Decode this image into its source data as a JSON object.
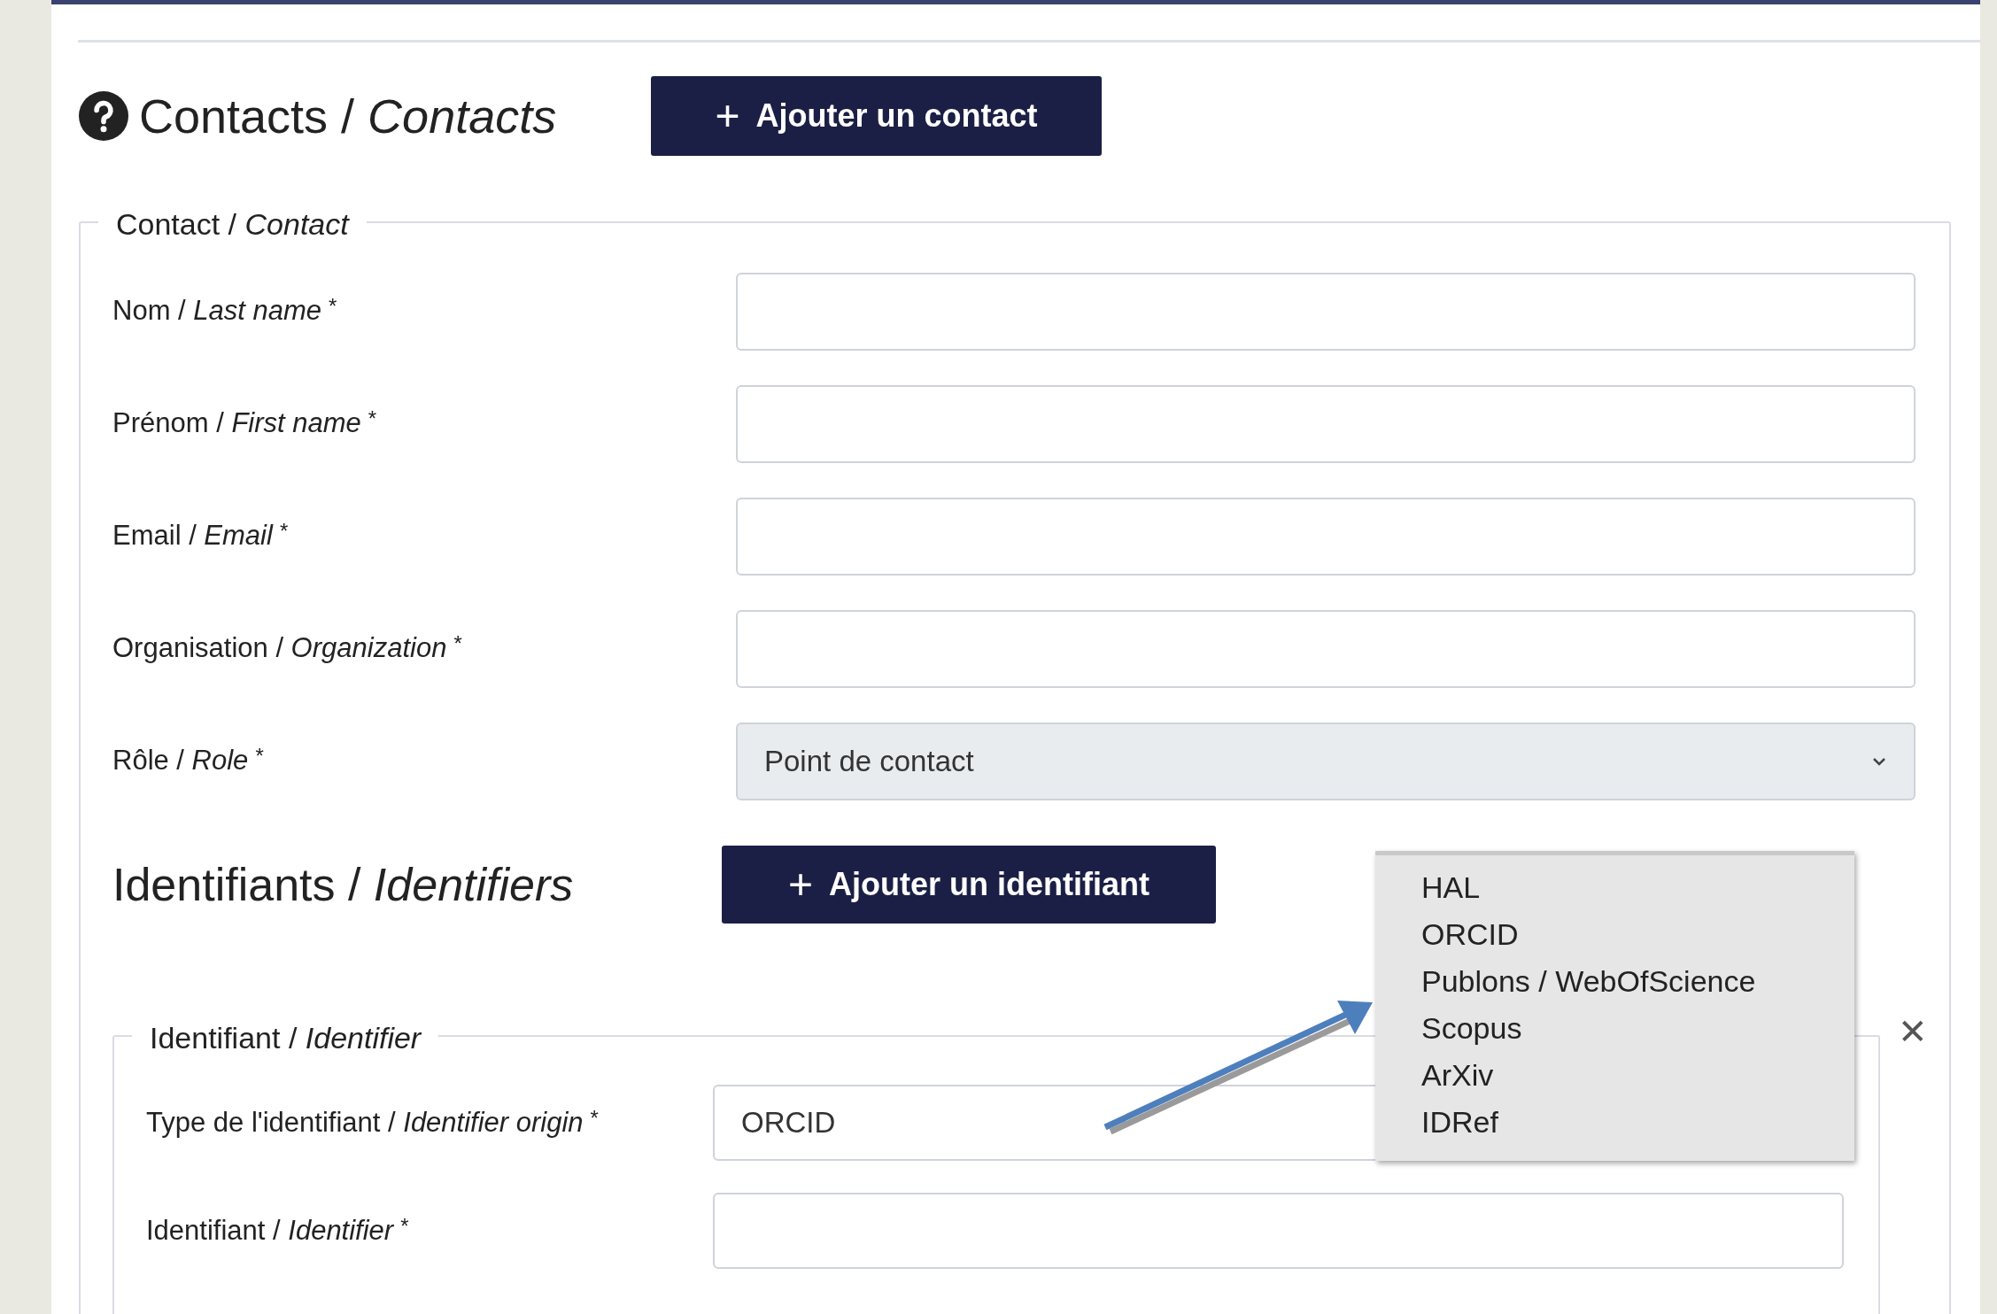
{
  "section": {
    "title": "Contacts / *Contacts*",
    "add_button": "Ajouter un contact",
    "add_icon": "+"
  },
  "contact_fieldset": {
    "legend": "Contact / *Contact*",
    "fields": [
      {
        "kind": "text",
        "label": "Nom / *Last name*",
        "required_mark": "*"
      },
      {
        "kind": "text",
        "label": "Prénom / *First name*",
        "required_mark": "*"
      },
      {
        "kind": "text",
        "label": "Email / *Email*",
        "required_mark": "*"
      },
      {
        "kind": "text",
        "label": "Organisation / *Organization*",
        "required_mark": "*"
      },
      {
        "kind": "select",
        "label": "Rôle / *Role*",
        "required_mark": "*",
        "value": "Point de contact"
      }
    ]
  },
  "identifiers": {
    "title": "Identifiants / *Identifiers*",
    "add_button": "Ajouter un identifiant",
    "add_icon": "+",
    "fieldset": {
      "legend": "Identifiant / *Identifier*",
      "close": "✕",
      "fields": [
        {
          "kind": "select",
          "label": "Type de l'identifiant / *Identifier origin*",
          "required_mark": "*",
          "value": "ORCID"
        },
        {
          "kind": "text",
          "label": "Identifiant / *Identifier*",
          "required_mark": "*"
        }
      ]
    }
  },
  "dropdown": {
    "options": [
      "HAL",
      "ORCID",
      "Publons / WebOfScience",
      "Scopus",
      "ArXiv",
      "IDRef"
    ]
  }
}
